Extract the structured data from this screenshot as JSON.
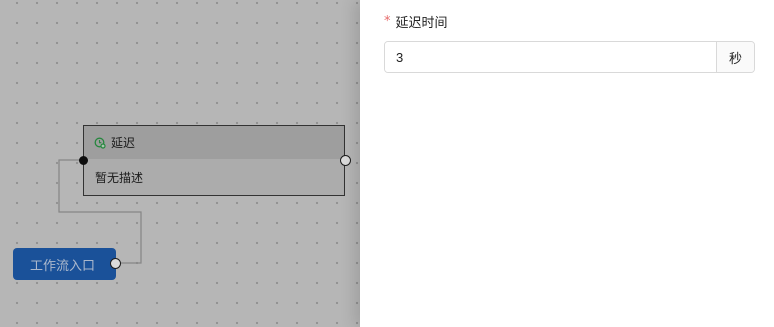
{
  "canvas": {
    "delay_node": {
      "title": "延迟",
      "description": "暂无描述",
      "icon": "clock-add-icon",
      "icon_color": "#2e9e4a"
    },
    "entry_node": {
      "label": "工作流入口",
      "color": "#1f5fb3"
    }
  },
  "panel": {
    "field": {
      "required_mark": "*",
      "label": "延迟时间",
      "value": "3",
      "unit": "秒"
    }
  }
}
